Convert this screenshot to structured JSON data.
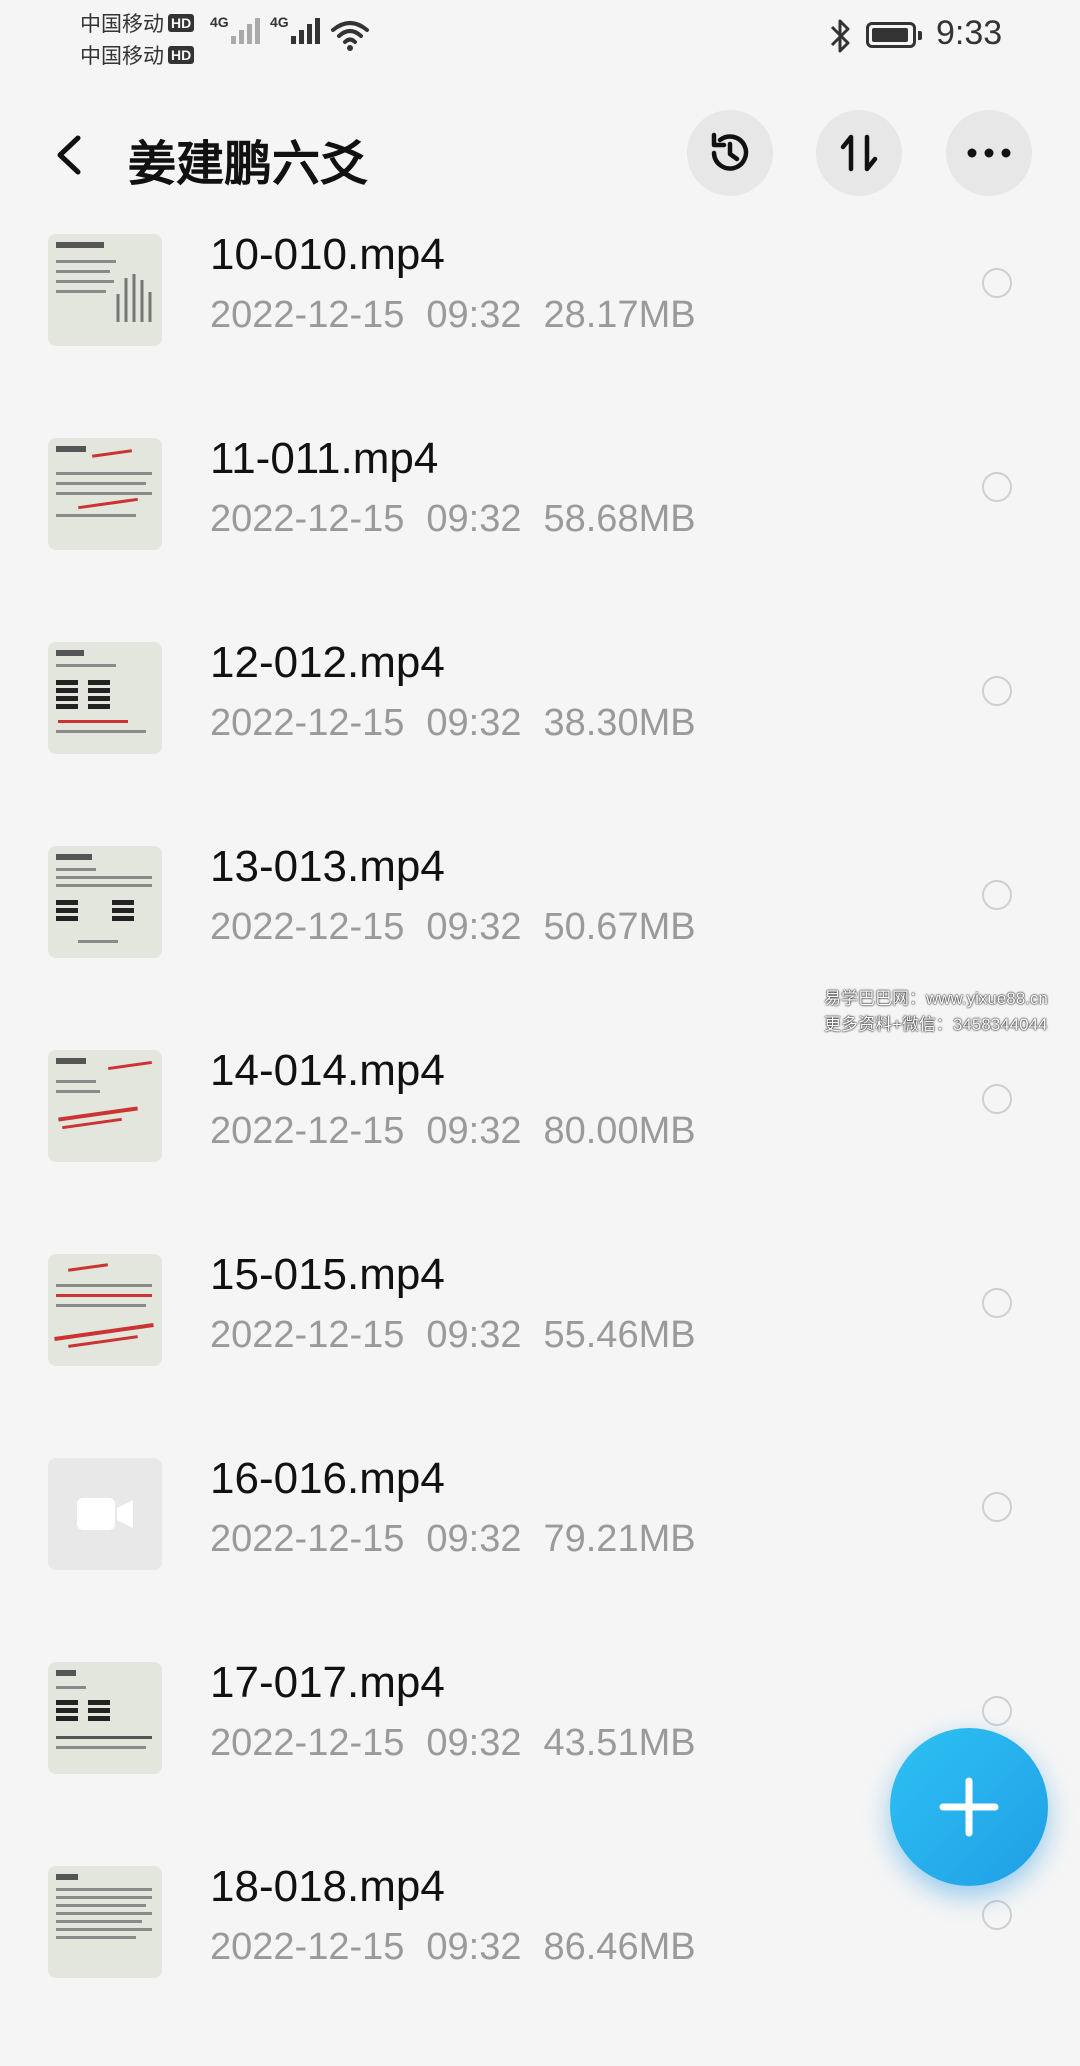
{
  "status_bar": {
    "carrier_1": "中国移动",
    "carrier_2": "中国移动",
    "hd_badge": "HD",
    "network_1": "4G",
    "network_2": "4G",
    "time": "9:33",
    "icons": [
      "signal-bars-icon",
      "wifi-icon",
      "bluetooth-icon",
      "battery-icon"
    ]
  },
  "header": {
    "title": "姜建鹏六爻",
    "back_icon": "chevron-left-icon",
    "actions": [
      "history-icon",
      "sort-icon",
      "more-icon"
    ]
  },
  "files": [
    {
      "name": "10-010.mp4",
      "date": "2022-12-15",
      "time": "09:32",
      "size": "28.17MB",
      "thumb": "doc"
    },
    {
      "name": "11-011.mp4",
      "date": "2022-12-15",
      "time": "09:32",
      "size": "58.68MB",
      "thumb": "doc"
    },
    {
      "name": "12-012.mp4",
      "date": "2022-12-15",
      "time": "09:32",
      "size": "38.30MB",
      "thumb": "doc"
    },
    {
      "name": "13-013.mp4",
      "date": "2022-12-15",
      "time": "09:32",
      "size": "50.67MB",
      "thumb": "doc"
    },
    {
      "name": "14-014.mp4",
      "date": "2022-12-15",
      "time": "09:32",
      "size": "80.00MB",
      "thumb": "doc"
    },
    {
      "name": "15-015.mp4",
      "date": "2022-12-15",
      "time": "09:32",
      "size": "55.46MB",
      "thumb": "doc"
    },
    {
      "name": "16-016.mp4",
      "date": "2022-12-15",
      "time": "09:32",
      "size": "79.21MB",
      "thumb": "video-placeholder"
    },
    {
      "name": "17-017.mp4",
      "date": "2022-12-15",
      "time": "09:32",
      "size": "43.51MB",
      "thumb": "doc"
    },
    {
      "name": "18-018.mp4",
      "date": "2022-12-15",
      "time": "09:32",
      "size": "86.46MB",
      "thumb": "doc"
    }
  ],
  "watermark": {
    "line1": "易学巴巴网：www.yixue88.cn",
    "line2": "更多资料+微信：3458344044"
  },
  "fab": {
    "icon": "plus-icon"
  },
  "colors": {
    "background": "#f5f5f5",
    "accent": "#1f9fe6",
    "meta_text": "#9a9a9a"
  }
}
